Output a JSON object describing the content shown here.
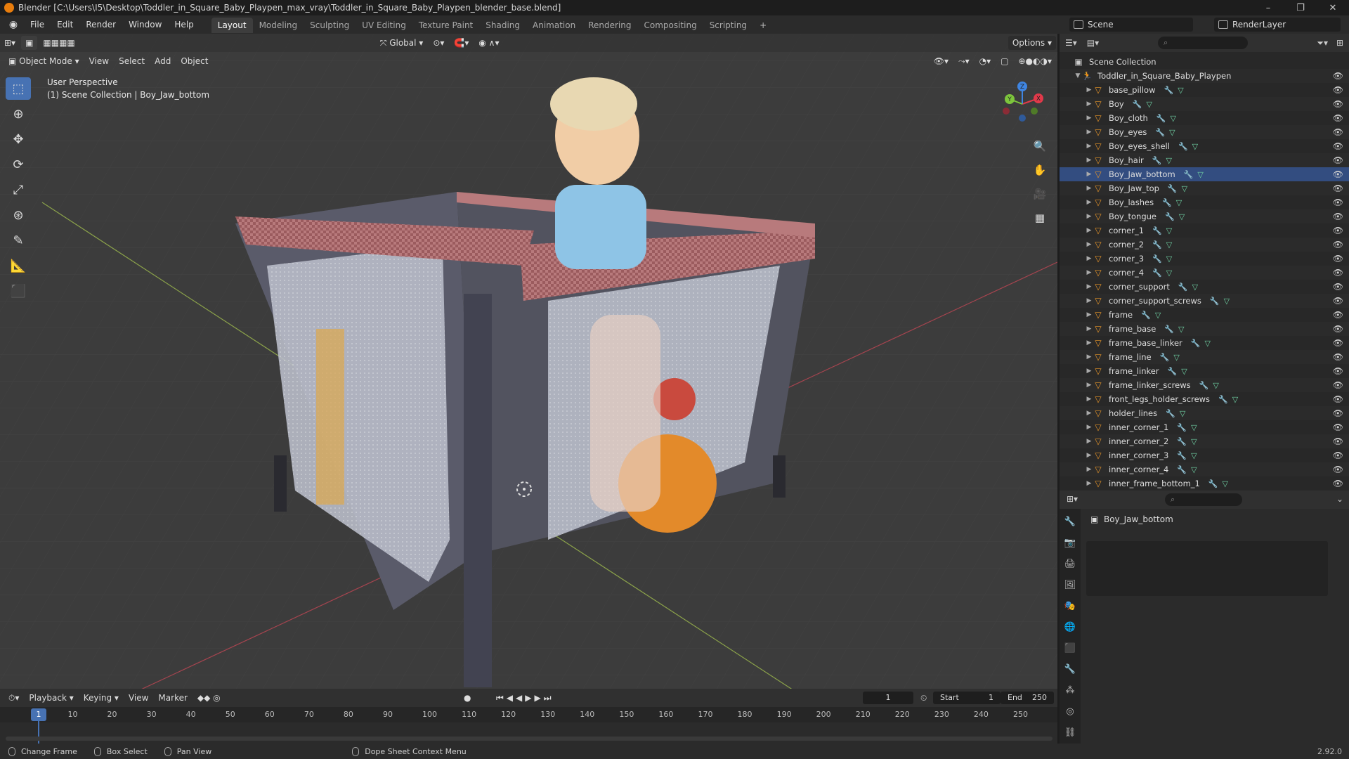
{
  "window": {
    "title": "Blender [C:\\Users\\I5\\Desktop\\Toddler_in_Square_Baby_Playpen_max_vray\\Toddler_in_Square_Baby_Playpen_blender_base.blend]",
    "controls": [
      "–",
      "❐",
      "✕"
    ]
  },
  "menu": [
    "File",
    "Edit",
    "Render",
    "Window",
    "Help"
  ],
  "workspaces": [
    "Layout",
    "Modeling",
    "Sculpting",
    "UV Editing",
    "Texture Paint",
    "Shading",
    "Animation",
    "Rendering",
    "Compositing",
    "Scripting",
    "+"
  ],
  "active_workspace": "Layout",
  "scene": {
    "name": "Scene",
    "render_layer": "RenderLayer"
  },
  "viewport": {
    "mode": "Object Mode",
    "header_menu": [
      "View",
      "Select",
      "Add",
      "Object"
    ],
    "orientation": "Global",
    "options_label": "Options",
    "perspective_label": "User Perspective",
    "collection_label": "(1) Scene Collection | Boy_Jaw_bottom",
    "gizmo_axes": [
      "X",
      "Y",
      "Z"
    ],
    "colors": {
      "x": "#e2394a",
      "y": "#7dc63c",
      "z": "#3f85e2",
      "accent": "#4772b3"
    }
  },
  "outliner": {
    "root": "Scene Collection",
    "collection": "Toddler_in_Square_Baby_Playpen",
    "objects": [
      "base_pillow",
      "Boy",
      "Boy_cloth",
      "Boy_eyes",
      "Boy_eyes_shell",
      "Boy_hair",
      "Boy_Jaw_bottom",
      "Boy_Jaw_top",
      "Boy_lashes",
      "Boy_tongue",
      "corner_1",
      "corner_2",
      "corner_3",
      "corner_4",
      "corner_support",
      "corner_support_screws",
      "frame",
      "frame_base",
      "frame_base_linker",
      "frame_line",
      "frame_linker",
      "frame_linker_screws",
      "front_legs_holder_screws",
      "holder_lines",
      "inner_corner_1",
      "inner_corner_2",
      "inner_corner_3",
      "inner_corner_4",
      "inner_frame_bottom_1"
    ]
  },
  "properties": {
    "object_name": "Boy_Jaw_bottom"
  },
  "timeline": {
    "menus": [
      "Playback",
      "Keying",
      "View",
      "Marker"
    ],
    "current_frame": "1",
    "start_label": "Start",
    "start": "1",
    "end_label": "End",
    "end": "250",
    "ticks": [
      "1",
      "10",
      "20",
      "30",
      "40",
      "50",
      "60",
      "70",
      "80",
      "90",
      "100",
      "110",
      "120",
      "130",
      "140",
      "150",
      "160",
      "170",
      "180",
      "190",
      "200",
      "210",
      "220",
      "230",
      "240",
      "250"
    ]
  },
  "statusbar": {
    "items": [
      "Change Frame",
      "Box Select",
      "Pan View",
      "Dope Sheet Context Menu"
    ],
    "version": "2.92.0"
  }
}
